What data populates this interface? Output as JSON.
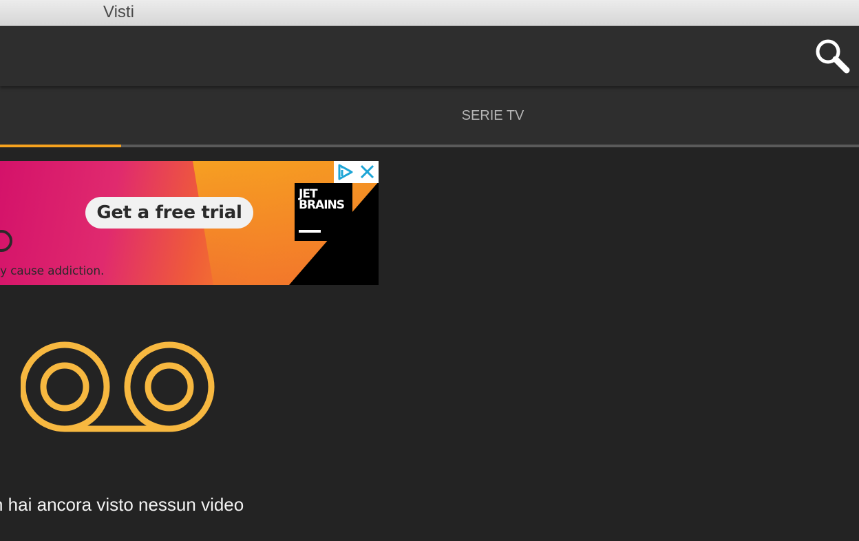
{
  "window": {
    "title": "Visti"
  },
  "toolbar": {
    "search_icon": "search-icon"
  },
  "tabs": {
    "left_label": "",
    "serie_label": "SERIE TV",
    "active_color": "#f6a21e"
  },
  "ad": {
    "cta": "Get a free trial",
    "disclaimer": "y cause addiction.",
    "brand": "JET\nBRAINS",
    "adchoices_icon": "adchoices-icon",
    "close_icon": "close-icon"
  },
  "empty_state": {
    "icon": "voicemail-icon",
    "icon_color": "#f7b840",
    "message": "n hai ancora visto nessun video"
  }
}
